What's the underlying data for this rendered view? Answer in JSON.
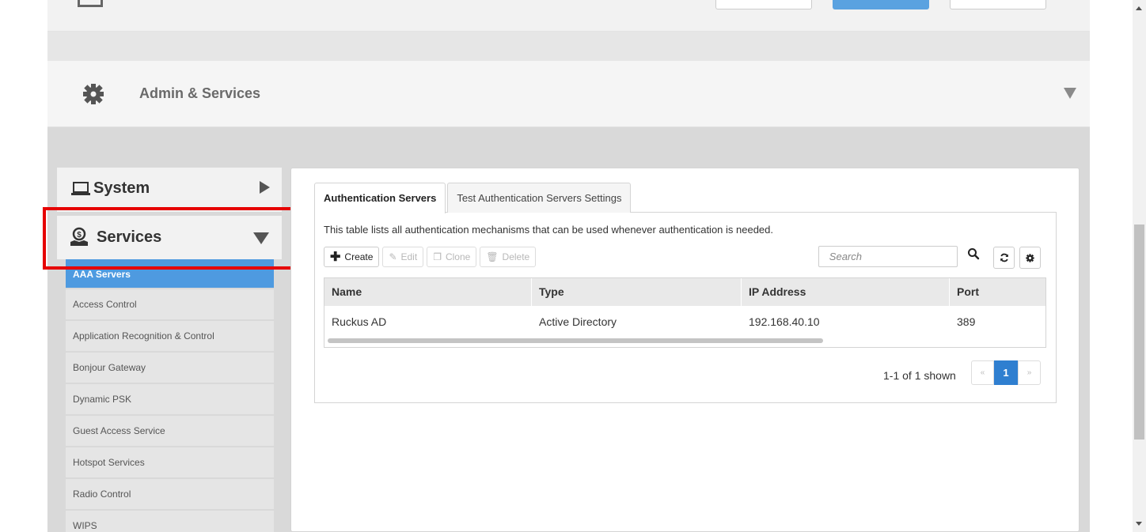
{
  "admin_header": {
    "title": "Admin & Services",
    "icon": "gear-icon"
  },
  "nav": {
    "system": {
      "label": "System",
      "icon": "laptop-icon"
    },
    "services": {
      "label": "Services",
      "icon": "services-icon"
    },
    "sub_items": [
      {
        "label": "AAA Servers",
        "active": true
      },
      {
        "label": "Access Control"
      },
      {
        "label": "Application Recognition & Control"
      },
      {
        "label": "Bonjour Gateway"
      },
      {
        "label": "Dynamic PSK"
      },
      {
        "label": "Guest Access Service"
      },
      {
        "label": "Hotspot Services"
      },
      {
        "label": "Radio Control"
      },
      {
        "label": "WIPS"
      }
    ]
  },
  "tabs": [
    {
      "label": "Authentication Servers",
      "active": true
    },
    {
      "label": "Test Authentication Servers Settings"
    }
  ],
  "description": "This table lists all authentication mechanisms that can be used whenever authentication is needed.",
  "toolbar": {
    "create": "Create",
    "edit": "Edit",
    "clone": "Clone",
    "delete": "Delete"
  },
  "search": {
    "placeholder": "Search"
  },
  "table": {
    "headers": [
      "Name",
      "Type",
      "IP Address",
      "Port"
    ],
    "rows": [
      [
        "Ruckus AD",
        "Active Directory",
        "192.168.40.10",
        "389"
      ]
    ]
  },
  "pager": {
    "summary": "1-1 of 1 shown",
    "prev": "«",
    "current": "1",
    "next": "»"
  },
  "colors": {
    "accent": "#4e9ae0",
    "highlight": "#e60000",
    "pager_active": "#2f7fd0"
  }
}
